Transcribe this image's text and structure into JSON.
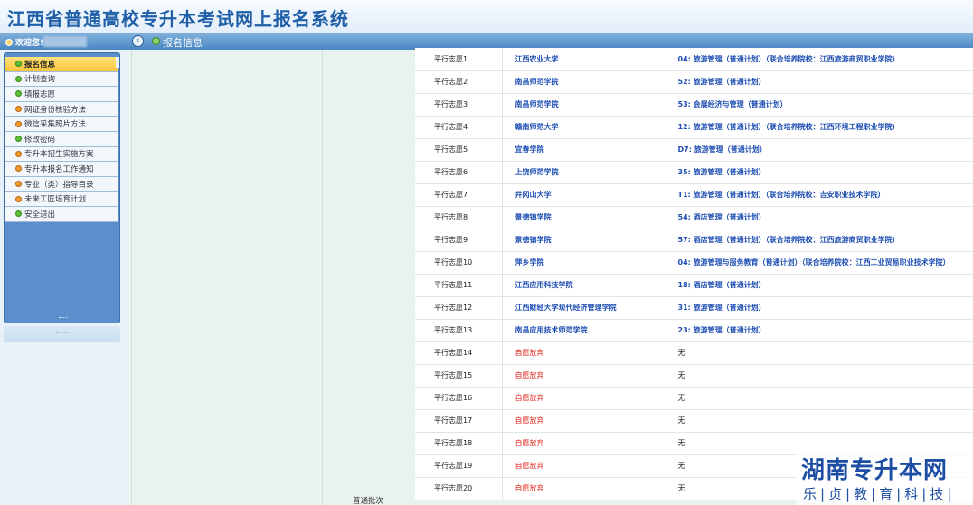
{
  "app": {
    "title": "江西省普通高校专升本考试网上报名系统"
  },
  "strip": {
    "welcome": "欢迎您!",
    "tab_label": "报名信息",
    "collapse_icon": "chevron-left-icon"
  },
  "sidebar": {
    "items": [
      {
        "label": "报名信息",
        "icon": "green-dot",
        "active": true
      },
      {
        "label": "计划查询",
        "icon": "green-dot"
      },
      {
        "label": "填报志愿",
        "icon": "green-dot"
      },
      {
        "label": "网证身份核验方法",
        "icon": "orange-dot"
      },
      {
        "label": "微信采集照片方法",
        "icon": "orange-dot"
      },
      {
        "label": "修改密码",
        "icon": "green-dot"
      },
      {
        "label": "专升本招生实施方案",
        "icon": "orange-dot"
      },
      {
        "label": "专升本报名工作通知",
        "icon": "orange-dot"
      },
      {
        "label": "专业（类）指导目录",
        "icon": "orange-dot"
      },
      {
        "label": "未来工匠培育计划",
        "icon": "orange-dot"
      },
      {
        "label": "安全退出",
        "icon": "green-dot"
      }
    ]
  },
  "batch": {
    "label": "普通批次"
  },
  "choices": [
    {
      "no": "平行志愿1",
      "school": "江西农业大学",
      "major": "04: 旅游管理（普通计划）（联合培养院校：江西旅游商贸职业学院）"
    },
    {
      "no": "平行志愿2",
      "school": "南昌师范学院",
      "major": "52: 旅游管理（普通计划）"
    },
    {
      "no": "平行志愿3",
      "school": "南昌师范学院",
      "major": "53: 会展经济与管理（普通计划）"
    },
    {
      "no": "平行志愿4",
      "school": "赣南师范大学",
      "major": "12: 旅游管理（普通计划）（联合培养院校：江西环境工程职业学院）"
    },
    {
      "no": "平行志愿5",
      "school": "宜春学院",
      "major": "D7: 旅游管理（普通计划）"
    },
    {
      "no": "平行志愿6",
      "school": "上饶师范学院",
      "major": "35: 旅游管理（普通计划）"
    },
    {
      "no": "平行志愿7",
      "school": "井冈山大学",
      "major": "T1: 旅游管理（普通计划）（联合培养院校：吉安职业技术学院）"
    },
    {
      "no": "平行志愿8",
      "school": "景德镇学院",
      "major": "54: 酒店管理（普通计划）"
    },
    {
      "no": "平行志愿9",
      "school": "景德镇学院",
      "major": "57: 酒店管理（普通计划）（联合培养院校：江西旅游商贸职业学院）"
    },
    {
      "no": "平行志愿10",
      "school": "萍乡学院",
      "major": "04: 旅游管理与服务教育（普通计划）（联合培养院校：江西工业贸易职业技术学院）"
    },
    {
      "no": "平行志愿11",
      "school": "江西应用科技学院",
      "major": "18: 酒店管理（普通计划）"
    },
    {
      "no": "平行志愿12",
      "school": "江西财经大学现代经济管理学院",
      "major": "31: 旅游管理（普通计划）"
    },
    {
      "no": "平行志愿13",
      "school": "南昌应用技术师范学院",
      "major": "23: 旅游管理（普通计划）"
    },
    {
      "no": "平行志愿14",
      "school": "自愿放弃",
      "major": "无",
      "give_up": true
    },
    {
      "no": "平行志愿15",
      "school": "自愿放弃",
      "major": "无",
      "give_up": true
    },
    {
      "no": "平行志愿16",
      "school": "自愿放弃",
      "major": "无",
      "give_up": true
    },
    {
      "no": "平行志愿17",
      "school": "自愿放弃",
      "major": "无",
      "give_up": true
    },
    {
      "no": "平行志愿18",
      "school": "自愿放弃",
      "major": "无",
      "give_up": true
    },
    {
      "no": "平行志愿19",
      "school": "自愿放弃",
      "major": "无",
      "give_up": true
    },
    {
      "no": "平行志愿20",
      "school": "自愿放弃",
      "major": "无",
      "give_up": true
    }
  ],
  "watermark": {
    "title": "湖南专升本网",
    "subtitle": "乐|贞|教|育|科|技|"
  }
}
